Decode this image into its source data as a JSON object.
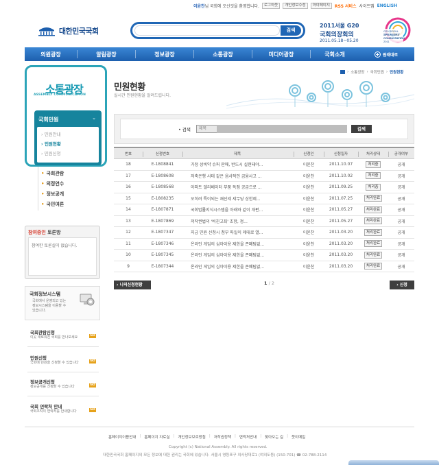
{
  "topbar": {
    "user": "이윤찬",
    "welcome": "님 국회에 오신것을 환영합니다.",
    "logout": "로그아웃",
    "privacy_edit": "개인정보수정",
    "my_page": "마이페이지",
    "rss": "RSS 서비스",
    "sitemap": "사이트맵",
    "english": "ENGLISH"
  },
  "logo": {
    "text": "대한민국국회"
  },
  "search": {
    "button": "검색",
    "placeholder": ""
  },
  "g20": {
    "line1": "2011서울 G20",
    "line2": "국회의장회의",
    "line3": "2011.05.18~05.20"
  },
  "nav": {
    "items": [
      "의원광장",
      "알림광장",
      "정보광장",
      "소통광장",
      "미디어광장",
      "국회소개"
    ],
    "more": "원래대로"
  },
  "sidebar": {
    "title": "소통광장",
    "subtitle": "ASSEMBLY COMMUNICATION",
    "active_section": "국회민원",
    "sub_items": [
      "민원안내",
      "민원현황",
      "민원신청"
    ],
    "active_sub": 1,
    "links": [
      "국회관람",
      "의정연수",
      "정보공개",
      "국민여론"
    ],
    "debate": {
      "title_red": "참여중인",
      "title_rest": " 토론방",
      "empty": "참여한 토론실이 없습니다."
    },
    "infosys": {
      "title": "국회정보시스템",
      "desc1": "국회에서 운영되고 있는",
      "desc2": "정보시스템을 이용할 수",
      "desc3": "있습니다."
    },
    "banners": [
      {
        "title": "국회관람신청",
        "desc": "이곳 새로워진 국회를 만나보세요",
        "go": "GO"
      },
      {
        "title": "민원신청",
        "desc": "국회에 민원을 신청할 수 있습니다",
        "go": "GO"
      },
      {
        "title": "정보공개신청",
        "desc": "정보공개를 신청할 수 있습니다",
        "go": "GO"
      },
      {
        "title": "국회 연락처 안내",
        "desc": "국회조직의 연락처를 안내합니다",
        "go": "GO"
      }
    ]
  },
  "breadcrumb": [
    "소통광장",
    "국회민원",
    "민원현황"
  ],
  "page": {
    "title": "민원현황",
    "subtitle": "실시간 민원현황을 알려드립니다."
  },
  "filter": {
    "label": "검색",
    "select_value": "제목",
    "button": "검색"
  },
  "table": {
    "headers": [
      "번호",
      "신청번호",
      "제목",
      "신청인",
      "신청일자",
      "처리상태",
      "공개여부"
    ],
    "rows": [
      {
        "num": "18",
        "code": "E-1808841",
        "title": "가정 상비약 슈퍼 판매, 반드시 실현돼야...",
        "name": "이윤찬",
        "date": "2011.10.07",
        "status": "처리중",
        "public": "공개"
      },
      {
        "num": "17",
        "code": "E-1808608",
        "title": "저축은행 사태 같은 음사적인 금융사고 ...",
        "name": "이윤찬",
        "date": "2011.10.02",
        "status": "처리중",
        "public": "공개"
      },
      {
        "num": "16",
        "code": "E-1808568",
        "title": "아파트 엘리베이터 부품 독점 공급으로 ...",
        "name": "이윤찬",
        "date": "2011.09.25",
        "status": "처리중",
        "public": "공개"
      },
      {
        "num": "15",
        "code": "E-1808235",
        "title": "오히려 특이되는 재산세 세무당 상한제...",
        "name": "이윤찬",
        "date": "2011.07.25",
        "status": "처리완료",
        "public": "공개"
      },
      {
        "num": "14",
        "code": "E-1807871",
        "title": "국회법률지식시스템을 아래와 같이 개편...",
        "name": "이윤찬",
        "date": "2011.05.27",
        "status": "처리완료",
        "public": "공개"
      },
      {
        "num": "13",
        "code": "E-1807869",
        "title": "저작권법의 '비친고죄' 조항, 정...",
        "name": "이윤찬",
        "date": "2011.05.27",
        "status": "처리완료",
        "public": "공개"
      },
      {
        "num": "12",
        "code": "E-1807347",
        "title": "지금 민원 신청시 첨부 파일이 제대로 열...",
        "name": "이윤찬",
        "date": "2011.03.20",
        "status": "처리완료",
        "public": "공개"
      },
      {
        "num": "11",
        "code": "E-1807346",
        "title": "온라인 게임의 심야이용 제한을 존폐팀없...",
        "name": "이윤찬",
        "date": "2011.03.20",
        "status": "처리완료",
        "public": "공개"
      },
      {
        "num": "10",
        "code": "E-1807345",
        "title": "온라인 게임의 심야이용 제한을 존폐팀없...",
        "name": "이윤찬",
        "date": "2011.03.20",
        "status": "처리완료",
        "public": "공개"
      },
      {
        "num": "9",
        "code": "E-1807344",
        "title": "온라인 게임의 심야이용 제한을 존폐팀없...",
        "name": "이윤찬",
        "date": "2011.03.20",
        "status": "처리완료",
        "public": "공개"
      }
    ]
  },
  "actions": {
    "my_list": "나의신청현황",
    "apply": "신청"
  },
  "pager": {
    "current": "1",
    "total": "2"
  },
  "footer": {
    "links": [
      "홈페이지이용안내",
      "홈페이지 자료실",
      "개인정보보호방침",
      "저작권정책",
      "연락처안내",
      "찾아오는 길",
      "뭇이메일"
    ],
    "copyright": "Copyright (c) National Assembly. All rights reserved.",
    "address": "대한민국국회 홈페이지의 모든 정보에 대한 권리는 국회에 있습니다. 서울시 영등포구 의사당대로1 (여의도동) (150-701) ☎ 02-788-2114"
  },
  "colors": {
    "brand_blue": "#1d5fae",
    "teal": "#16849d",
    "orange": "#e29a19"
  }
}
